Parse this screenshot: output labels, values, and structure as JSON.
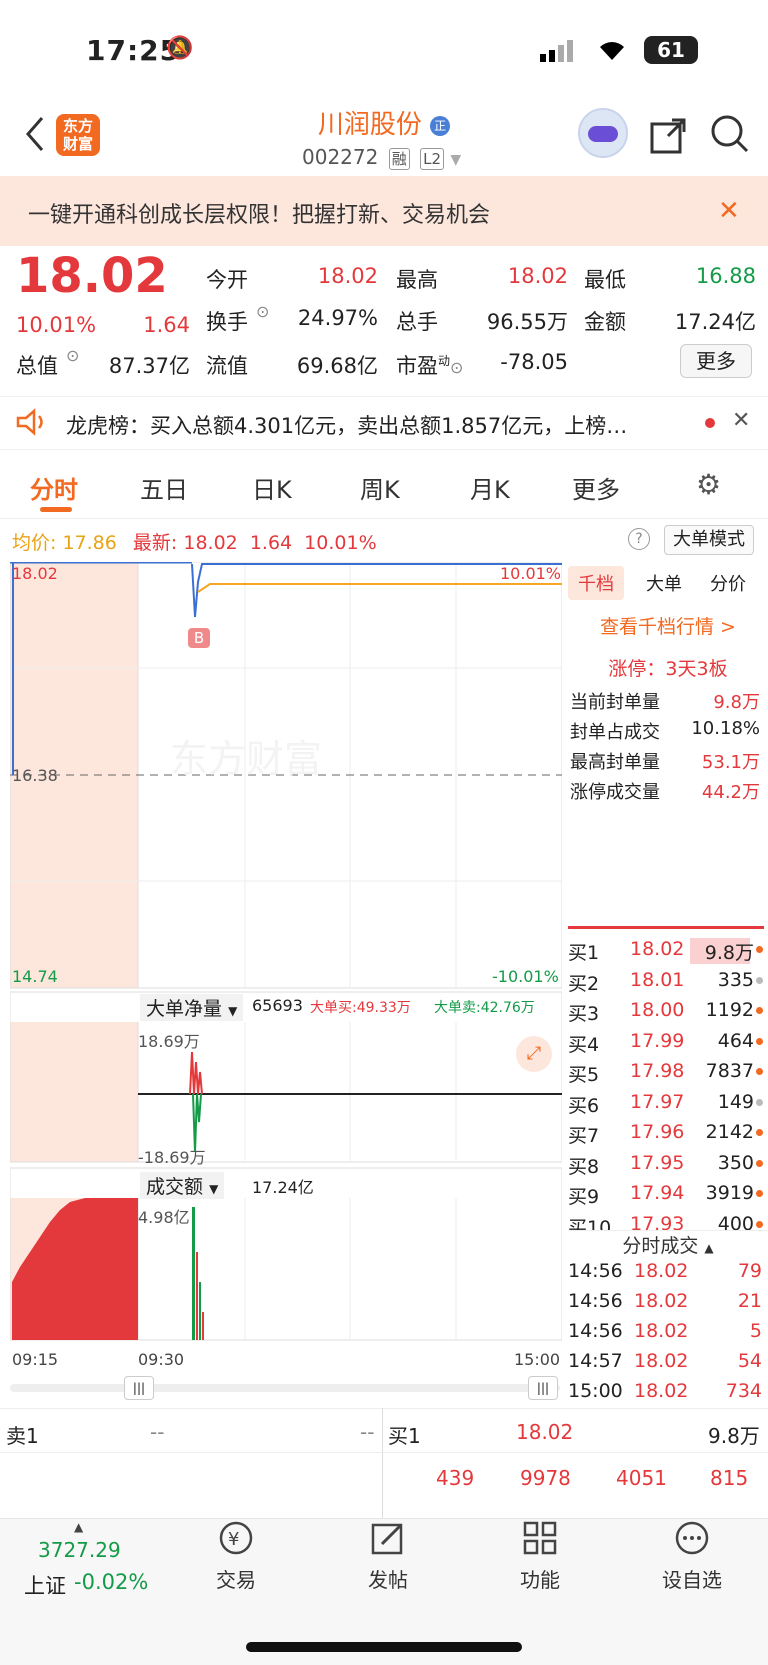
{
  "status_bar": {
    "time": "17:25",
    "battery": "61"
  },
  "header": {
    "logo_line1": "东方",
    "logo_line2": "财富",
    "name": "川润股份",
    "code": "002272",
    "tag1": "融",
    "tag2": "L2"
  },
  "banner": {
    "text": "一键开通科创成长层权限！把握打新、交易机会"
  },
  "quote": {
    "price": "18.02",
    "change_pct": "10.01%",
    "change": "1.64",
    "open_label": "今开",
    "open": "18.02",
    "high_label": "最高",
    "high": "18.02",
    "low_label": "最低",
    "low": "16.88",
    "turnover_label": "换手",
    "turnover": "24.97%",
    "volume_label": "总手",
    "volume": "96.55万",
    "amount_label": "金额",
    "amount": "17.24亿",
    "mktcap_label": "总值",
    "mktcap": "87.37亿",
    "float_label": "流值",
    "float": "69.68亿",
    "pe_label": "市盈",
    "pe_sup": "动",
    "pe": "-78.05",
    "more": "更多"
  },
  "notice": {
    "text": "龙虎榜：买入总额4.301亿元，卖出总额1.857亿元，上榜…"
  },
  "tabs": [
    "分时",
    "五日",
    "日K",
    "周K",
    "月K",
    "更多"
  ],
  "chart_info": {
    "avg_label": "均价:",
    "avg": "17.86",
    "last_label": "最新:",
    "last": "18.02",
    "chg": "1.64",
    "pct": "10.01%",
    "mode_btn": "大单模式"
  },
  "price_chart": {
    "top_price": "18.02",
    "mid_price": "16.38",
    "bottom_price": "14.74",
    "top_pct": "10.01%",
    "bottom_pct": "-10.01%",
    "watermark": "东方财富",
    "marker": "B"
  },
  "flow_panel": {
    "selector": "大单净量",
    "value": "65693",
    "buy_label": "大单买:49.33万",
    "sell_label": "大单卖:42.76万",
    "top": "18.69万",
    "bottom": "-18.69万"
  },
  "amount_panel": {
    "selector": "成交额",
    "value": "17.24亿",
    "top": "4.98亿"
  },
  "time_axis": [
    "09:15",
    "09:30",
    "15:00"
  ],
  "side_tabs": [
    "千档",
    "大单",
    "分价"
  ],
  "side": {
    "link": "查看千档行情 >",
    "limit_up": "涨停：3天3板",
    "stats": [
      {
        "label": "当前封单量",
        "value": "9.8万"
      },
      {
        "label": "封单占成交",
        "value": "10.18%"
      },
      {
        "label": "最高封单量",
        "value": "53.1万"
      },
      {
        "label": "涨停成交量",
        "value": "44.2万"
      }
    ]
  },
  "orderbook": [
    {
      "label": "买1",
      "price": "18.02",
      "vol": "9.8万"
    },
    {
      "label": "买2",
      "price": "18.01",
      "vol": "335"
    },
    {
      "label": "买3",
      "price": "18.00",
      "vol": "1192"
    },
    {
      "label": "买4",
      "price": "17.99",
      "vol": "464"
    },
    {
      "label": "买5",
      "price": "17.98",
      "vol": "7837"
    },
    {
      "label": "买6",
      "price": "17.97",
      "vol": "149"
    },
    {
      "label": "买7",
      "price": "17.96",
      "vol": "2142"
    },
    {
      "label": "买8",
      "price": "17.95",
      "vol": "350"
    },
    {
      "label": "买9",
      "price": "17.94",
      "vol": "3919"
    },
    {
      "label": "买10",
      "price": "17.93",
      "vol": "400"
    }
  ],
  "ticks_title": "分时成交",
  "ticks": [
    {
      "time": "14:56",
      "price": "18.02",
      "vol": "79"
    },
    {
      "time": "14:56",
      "price": "18.02",
      "vol": "21"
    },
    {
      "time": "14:56",
      "price": "18.02",
      "vol": "5"
    },
    {
      "time": "14:57",
      "price": "18.02",
      "vol": "54"
    },
    {
      "time": "15:00",
      "price": "18.02",
      "vol": "734"
    }
  ],
  "lower_book": {
    "sell1_label": "卖1",
    "sell1_price": "--",
    "sell1_vol": "--",
    "buy1_label": "买1",
    "buy1_price": "18.02",
    "buy1_vol": "9.8万",
    "queue": [
      "439",
      "9978",
      "4051",
      "815"
    ]
  },
  "bottom_nav": {
    "index_value": "3727.29",
    "index_name": "上证",
    "index_pct": "-0.02%",
    "trade": "交易",
    "post": "发帖",
    "func": "功能",
    "watch": "设自选"
  }
}
